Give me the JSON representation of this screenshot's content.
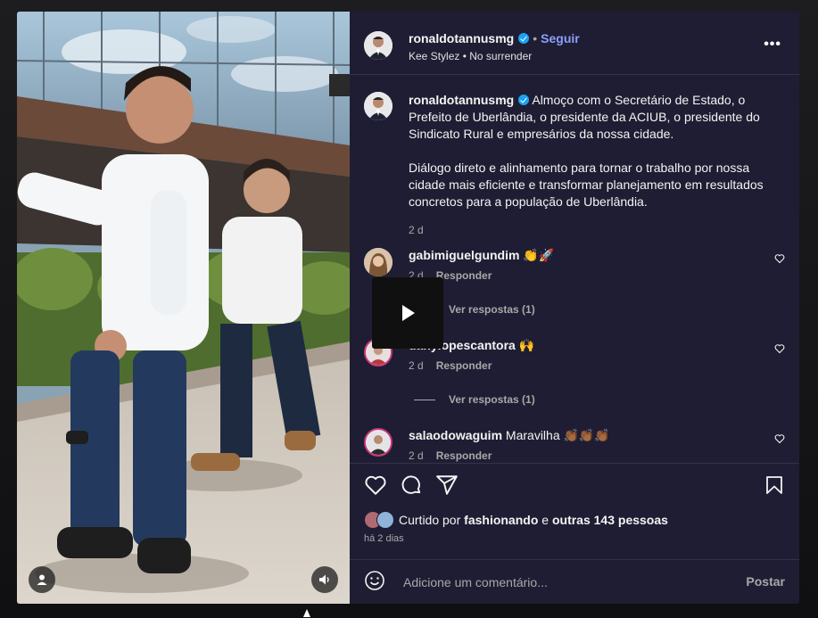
{
  "post": {
    "username": "ronaldotannusmg",
    "follow_label": "Seguir",
    "audio_label": "Kee Stylez • No surrender",
    "caption_p1": "Almoço com o Secretário de Estado, o Prefeito de Uberlândia, o presidente da ACIUB, o presidente do Sindicato Rural e empresários da nossa cidade.",
    "caption_p2": "Diálogo direto e alinhamento para tornar o trabalho por nossa cidade mais eficiente e transformar planejamento em resultados concretos para a população de Uberlândia.",
    "caption_time": "2 d",
    "posted_ago": "há 2 dias"
  },
  "comments": [
    {
      "username": "gabimiguelgundim",
      "text": "👏🚀",
      "time": "2 d",
      "reply_label": "Responder",
      "view_replies": "Ver respostas (1)"
    },
    {
      "username": "danylopescantora",
      "text": "🙌",
      "time": "2 d",
      "reply_label": "Responder",
      "view_replies": "Ver respostas (1)"
    },
    {
      "username": "salaodowaguim",
      "text": "Maravilha 👏🏾👏🏾👏🏾",
      "time": "2 d",
      "reply_label": "Responder"
    }
  ],
  "likes": {
    "prefix": "Curtido por",
    "first_user": "fashionando",
    "connector": "e",
    "others": "outras 143 pessoas"
  },
  "comment_box": {
    "placeholder": "Adicione um comentário...",
    "post_label": "Postar"
  },
  "icons": {
    "more": "more-options-icon",
    "heart": "heart-icon",
    "comment": "comment-icon",
    "share": "share-icon",
    "save": "bookmark-icon",
    "emoji": "emoji-icon",
    "play": "play-icon",
    "audio": "speaker-icon",
    "user_tag": "user-tag-icon"
  },
  "colors": {
    "panel_bg": "#1f1d33",
    "follow": "#8aa0ff",
    "verified": "#1da1f2",
    "muted_text": "#a8a8a8"
  }
}
